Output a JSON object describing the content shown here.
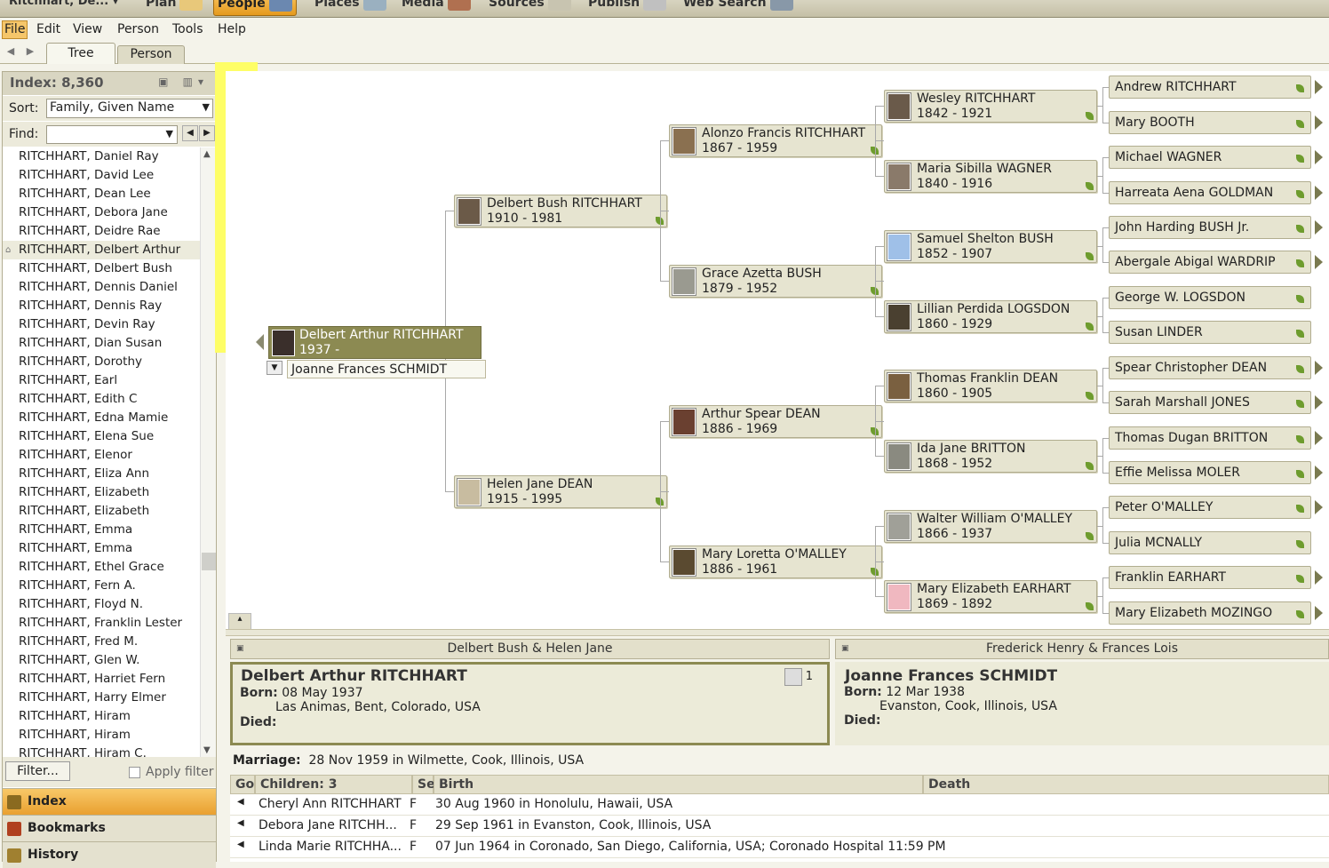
{
  "topbar": {
    "tree_name": "Ritchhart, De...",
    "modules": [
      "Plan",
      "People",
      "Places",
      "Media",
      "Sources",
      "Publish",
      "Web Search"
    ]
  },
  "menu": [
    "File",
    "Edit",
    "View",
    "Person",
    "Tools",
    "Help"
  ],
  "view_tabs": [
    "Tree",
    "Person"
  ],
  "index": {
    "title": "Index: 8,360",
    "sort_label": "Sort:",
    "sort_value": "Family, Given Name",
    "find_label": "Find:",
    "names": [
      "RITCHHART, Daniel Ray",
      "RITCHHART, David Lee",
      "RITCHHART, Dean Lee",
      "RITCHHART, Debora Jane",
      "RITCHHART, Deidre Rae",
      "RITCHHART, Delbert Arthur",
      "RITCHHART, Delbert Bush",
      "RITCHHART, Dennis Daniel",
      "RITCHHART, Dennis Ray",
      "RITCHHART, Devin Ray",
      "RITCHHART, Dian Susan",
      "RITCHHART, Dorothy",
      "RITCHHART, Earl",
      "RITCHHART, Edith C",
      "RITCHHART, Edna Mamie",
      "RITCHHART, Elena Sue",
      "RITCHHART, Elenor",
      "RITCHHART, Eliza Ann",
      "RITCHHART, Elizabeth",
      "RITCHHART, Elizabeth",
      "RITCHHART, Emma",
      "RITCHHART, Emma",
      "RITCHHART, Ethel Grace",
      "RITCHHART, Fern A.",
      "RITCHHART, Floyd N.",
      "RITCHHART, Franklin Lester",
      "RITCHHART, Fred M.",
      "RITCHHART, Glen W.",
      "RITCHHART, Harriet Fern",
      "RITCHHART, Harry Elmer",
      "RITCHHART, Hiram",
      "RITCHHART, Hiram",
      "RITCHHART, Hiram C."
    ],
    "selected_index": 5,
    "filter_button": "Filter...",
    "apply_filter": "Apply filter"
  },
  "left_nav": [
    "Index",
    "Bookmarks",
    "History"
  ],
  "tree": {
    "root": {
      "name": "Delbert Arthur RITCHHART",
      "dates": "1937 -"
    },
    "spouse": "Joanne Frances SCHMIDT",
    "parents": [
      {
        "name": "Delbert Bush RITCHHART",
        "dates": "1910 - 1981"
      },
      {
        "name": "Helen Jane DEAN",
        "dates": "1915 - 1995"
      }
    ],
    "grandparents": [
      {
        "name": "Alonzo Francis RITCHHART",
        "dates": "1867 - 1959"
      },
      {
        "name": "Grace Azetta BUSH",
        "dates": "1879 - 1952"
      },
      {
        "name": "Arthur Spear DEAN",
        "dates": "1886 - 1969"
      },
      {
        "name": "Mary Loretta O'MALLEY",
        "dates": "1886 - 1961"
      }
    ],
    "great_grandparents": [
      {
        "name": "Wesley RITCHHART",
        "dates": "1842 - 1921"
      },
      {
        "name": "Maria Sibilla WAGNER",
        "dates": "1840 - 1916"
      },
      {
        "name": "Samuel Shelton BUSH",
        "dates": "1852 - 1907"
      },
      {
        "name": "Lillian Perdida LOGSDON",
        "dates": "1860 - 1929"
      },
      {
        "name": "Thomas Franklin DEAN",
        "dates": "1860 - 1905"
      },
      {
        "name": "Ida Jane BRITTON",
        "dates": "1868 - 1952"
      },
      {
        "name": "Walter William O'MALLEY",
        "dates": "1866 - 1937"
      },
      {
        "name": "Mary Elizabeth EARHART",
        "dates": "1869 - 1892"
      }
    ],
    "gen5": [
      "Andrew RITCHHART",
      "Mary BOOTH",
      "Michael WAGNER",
      "Harreata Aena GOLDMAN",
      "John Harding BUSH Jr.",
      "Abergale Abigal WARDRIP",
      "George W. LOGSDON",
      "Susan LINDER",
      "Spear Christopher DEAN",
      "Sarah Marshall JONES",
      "Thomas Dugan BRITTON",
      "Effie Melissa MOLER",
      "Peter O'MALLEY",
      "Julia MCNALLY",
      "Franklin EARHART",
      "Mary Elizabeth MOZINGO"
    ]
  },
  "family": {
    "left_header": "Delbert Bush & Helen Jane",
    "right_header": "Frederick Henry & Frances Lois",
    "husband": {
      "name": "Delbert Arthur RITCHHART",
      "born_label": "Born:",
      "born": "08 May 1937",
      "born_place": "Las Animas, Bent, Colorado, USA",
      "died_label": "Died:",
      "media_count": "1"
    },
    "wife": {
      "name": "Joanne Frances SCHMIDT",
      "born_label": "Born:",
      "born": "12 Mar 1938",
      "born_place": "Evanston, Cook, Illinois, USA",
      "died_label": "Died:"
    },
    "marriage_label": "Marriage:",
    "marriage": "28 Nov 1959 in Wilmette, Cook, Illinois, USA",
    "children_headers": {
      "go": "Go",
      "children": "Children: 3",
      "sex": "Sex",
      "birth": "Birth",
      "death": "Death"
    },
    "children": [
      {
        "name": "Cheryl Ann RITCHHART",
        "sex": "F",
        "birth": "30 Aug 1960 in Honolulu, Hawaii, USA",
        "death": ""
      },
      {
        "name": "Debora Jane RITCHH...",
        "sex": "F",
        "birth": "29 Sep 1961 in Evanston, Cook, Illinois, USA",
        "death": ""
      },
      {
        "name": "Linda Marie RITCHHA...",
        "sex": "F",
        "birth": "07 Jun 1964 in Coronado, San Diego, California, USA; Coronado Hospital 11:59 PM",
        "death": ""
      }
    ]
  }
}
